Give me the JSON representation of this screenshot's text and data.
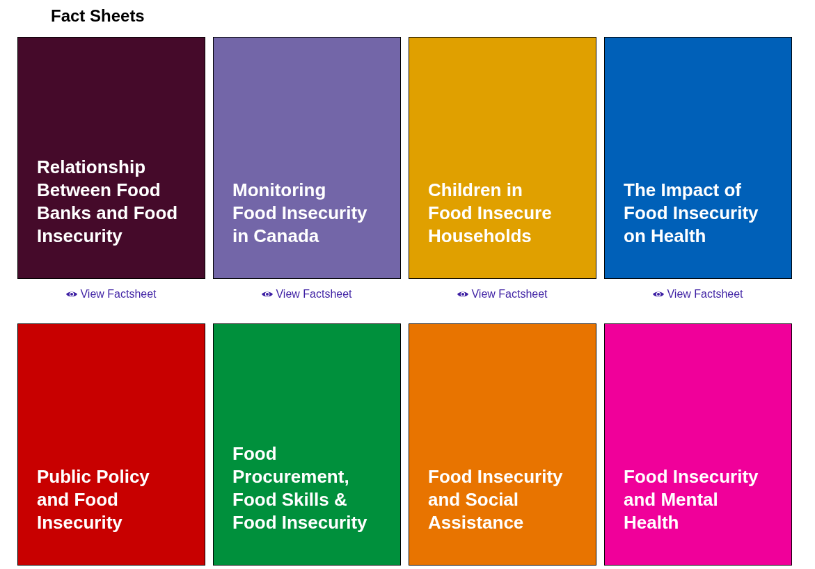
{
  "heading": "Fact Sheets",
  "cards": [
    {
      "title": "Relationship\nBetween Food\nBanks and Food\nInsecurity",
      "color": "#450a2a",
      "link": "View Factsheet"
    },
    {
      "title": "Monitoring\nFood Insecurity\nin Canada",
      "color": "#7366a8",
      "link": "View Factsheet"
    },
    {
      "title": "Children in\nFood Insecure\nHouseholds",
      "color": "#e0a000",
      "link": "View Factsheet"
    },
    {
      "title": "The Impact of\nFood Insecurity\non Health",
      "color": "#0060b8",
      "link": "View Factsheet"
    },
    {
      "title": "Public Policy\nand Food\nInsecurity",
      "color": "#c80000"
    },
    {
      "title": "Food\nProcurement,\nFood Skills &\nFood Insecurity",
      "color": "#00903c"
    },
    {
      "title": "Food Insecurity\nand Social\nAssistance",
      "color": "#e87400"
    },
    {
      "title": "Food Insecurity\nand Mental\nHealth",
      "color": "#f0009a"
    }
  ]
}
